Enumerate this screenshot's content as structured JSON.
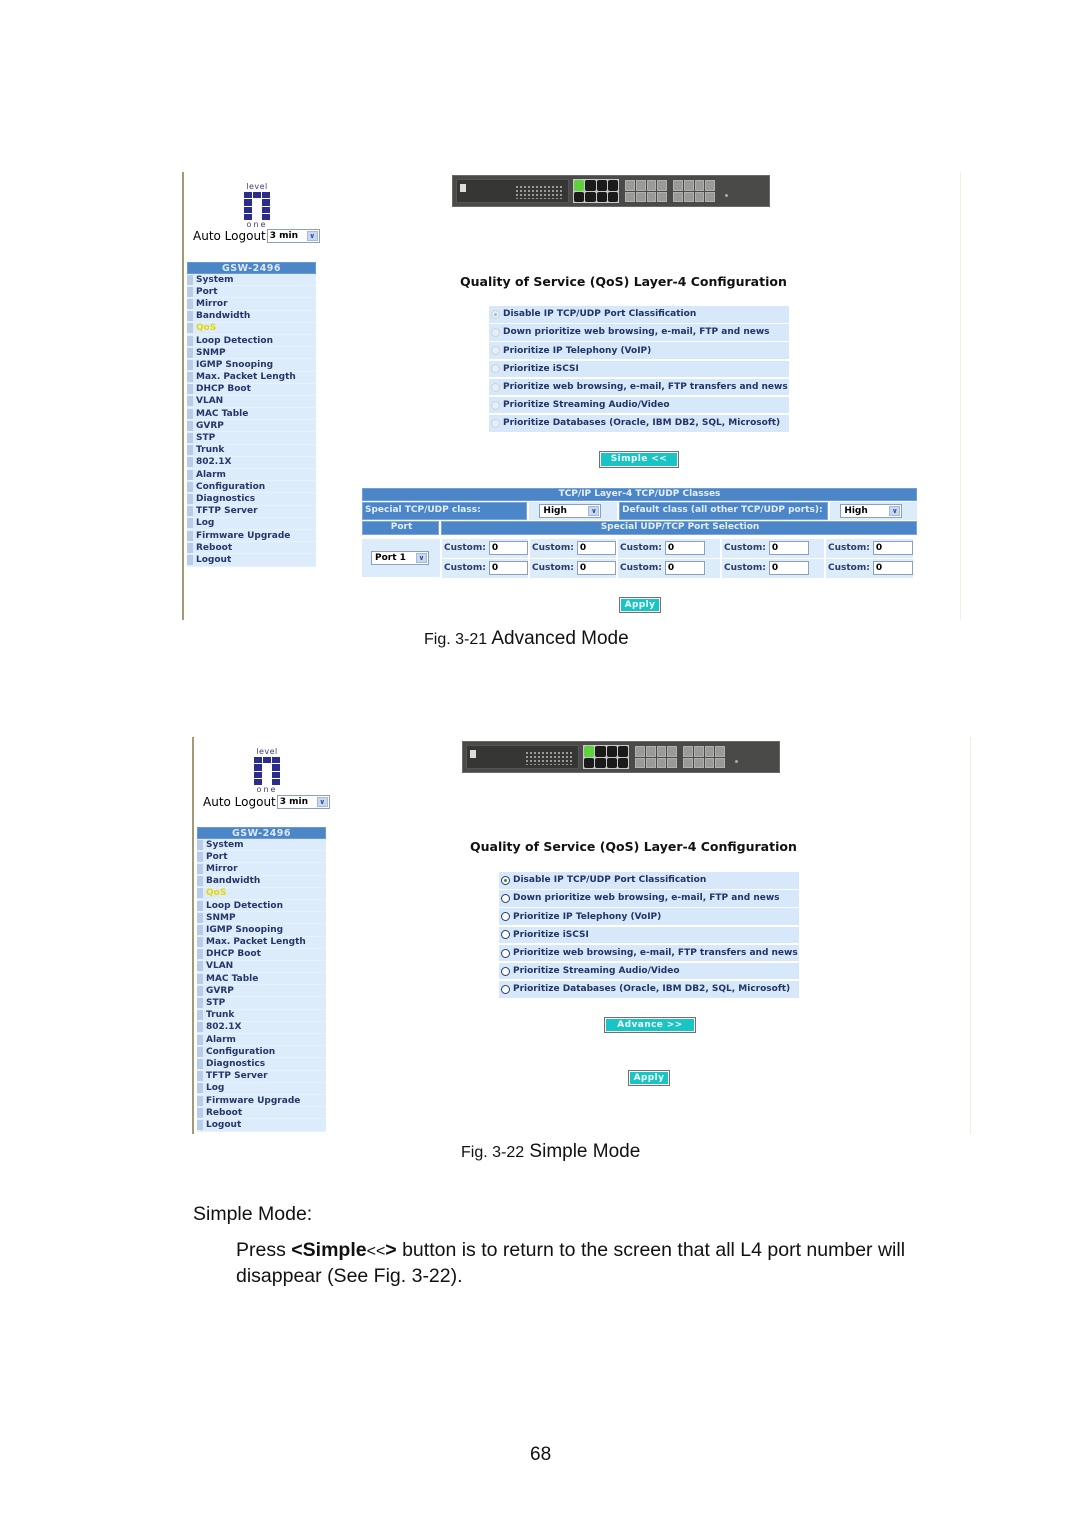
{
  "figures": [
    {
      "id": "advanced",
      "caption_number": "Fig. 3-21",
      "caption_title": "Advanced Mode",
      "logo": {
        "top": "level",
        "bottom": "one"
      },
      "auto_logout": {
        "label": "Auto Logout",
        "value": "3 min"
      },
      "nav": {
        "header": "GSW-2496",
        "items": [
          "System",
          "Port",
          "Mirror",
          "Bandwidth",
          "QoS",
          "Loop Detection",
          "SNMP",
          "IGMP Snooping",
          "Max. Packet Length",
          "DHCP Boot",
          "VLAN",
          "MAC Table",
          "GVRP",
          "STP",
          "Trunk",
          "802.1X",
          "Alarm",
          "Configuration",
          "Diagnostics",
          "TFTP Server",
          "Log",
          "Firmware Upgrade",
          "Reboot",
          "Logout"
        ],
        "active": "QoS"
      },
      "title": "Quality of Service (QoS) Layer-4 Configuration",
      "options": [
        "Disable IP TCP/UDP Port Classification",
        "Down prioritize web browsing, e-mail, FTP and news",
        "Prioritize IP Telephony (VoIP)",
        "Prioritize iSCSI",
        "Prioritize web browsing, e-mail, FTP transfers and news",
        "Prioritize Streaming Audio/Video",
        "Prioritize Databases (Oracle, IBM DB2, SQL, Microsoft)"
      ],
      "selected_option": 0,
      "mode_button": "Simple <<",
      "classes_table": {
        "title": "TCP/IP Layer-4 TCP/UDP Classes",
        "special_label": "Special TCP/UDP class:",
        "special_value": "High",
        "default_label": "Default class (all other TCP/UDP ports):",
        "default_value": "High",
        "port_header": "Port",
        "selection_header": "Special UDP/TCP Port Selection",
        "port_value": "Port 1",
        "custom_label": "Custom:",
        "custom_values": [
          [
            "0",
            "0",
            "0",
            "0",
            "0"
          ],
          [
            "0",
            "0",
            "0",
            "0",
            "0"
          ]
        ]
      },
      "apply_button": "Apply"
    },
    {
      "id": "simple",
      "caption_number": "Fig. 3-22",
      "caption_title": "Simple Mode",
      "logo": {
        "top": "level",
        "bottom": "one"
      },
      "auto_logout": {
        "label": "Auto Logout",
        "value": "3 min"
      },
      "nav": {
        "header": "GSW-2496",
        "items": [
          "System",
          "Port",
          "Mirror",
          "Bandwidth",
          "QoS",
          "Loop Detection",
          "SNMP",
          "IGMP Snooping",
          "Max. Packet Length",
          "DHCP Boot",
          "VLAN",
          "MAC Table",
          "GVRP",
          "STP",
          "Trunk",
          "802.1X",
          "Alarm",
          "Configuration",
          "Diagnostics",
          "TFTP Server",
          "Log",
          "Firmware Upgrade",
          "Reboot",
          "Logout"
        ],
        "active": "QoS"
      },
      "title": "Quality of Service (QoS) Layer-4 Configuration",
      "options": [
        "Disable IP TCP/UDP Port Classification",
        "Down prioritize web browsing, e-mail, FTP and news",
        "Prioritize IP Telephony (VoIP)",
        "Prioritize iSCSI",
        "Prioritize web browsing, e-mail, FTP transfers and news",
        "Prioritize Streaming Audio/Video",
        "Prioritize Databases (Oracle, IBM DB2, SQL, Microsoft)"
      ],
      "selected_option": 0,
      "mode_button": "Advance >>",
      "apply_button": "Apply"
    }
  ],
  "section_heading": "Simple Mode:",
  "paragraph": {
    "prefix": "Press ",
    "bold_open": "<",
    "bold_word": "Simple",
    "middle": "<<",
    "bold_close": ">",
    "suffix": " button is to return to the screen that all L4 port number will disappear (See Fig. 3-22)."
  },
  "page_number": "68"
}
